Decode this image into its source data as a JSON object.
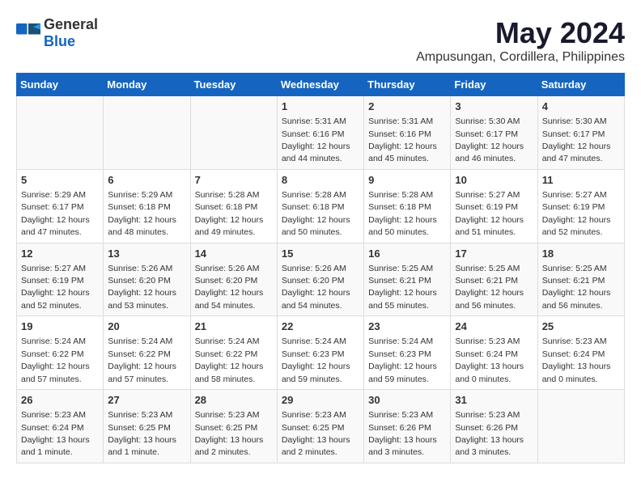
{
  "header": {
    "logo_general": "General",
    "logo_blue": "Blue",
    "month_title": "May 2024",
    "location": "Ampusungan, Cordillera, Philippines"
  },
  "days_of_week": [
    "Sunday",
    "Monday",
    "Tuesday",
    "Wednesday",
    "Thursday",
    "Friday",
    "Saturday"
  ],
  "weeks": [
    [
      {
        "day": "",
        "info": ""
      },
      {
        "day": "",
        "info": ""
      },
      {
        "day": "",
        "info": ""
      },
      {
        "day": "1",
        "info": "Sunrise: 5:31 AM\nSunset: 6:16 PM\nDaylight: 12 hours\nand 44 minutes."
      },
      {
        "day": "2",
        "info": "Sunrise: 5:31 AM\nSunset: 6:16 PM\nDaylight: 12 hours\nand 45 minutes."
      },
      {
        "day": "3",
        "info": "Sunrise: 5:30 AM\nSunset: 6:17 PM\nDaylight: 12 hours\nand 46 minutes."
      },
      {
        "day": "4",
        "info": "Sunrise: 5:30 AM\nSunset: 6:17 PM\nDaylight: 12 hours\nand 47 minutes."
      }
    ],
    [
      {
        "day": "5",
        "info": "Sunrise: 5:29 AM\nSunset: 6:17 PM\nDaylight: 12 hours\nand 47 minutes."
      },
      {
        "day": "6",
        "info": "Sunrise: 5:29 AM\nSunset: 6:18 PM\nDaylight: 12 hours\nand 48 minutes."
      },
      {
        "day": "7",
        "info": "Sunrise: 5:28 AM\nSunset: 6:18 PM\nDaylight: 12 hours\nand 49 minutes."
      },
      {
        "day": "8",
        "info": "Sunrise: 5:28 AM\nSunset: 6:18 PM\nDaylight: 12 hours\nand 50 minutes."
      },
      {
        "day": "9",
        "info": "Sunrise: 5:28 AM\nSunset: 6:18 PM\nDaylight: 12 hours\nand 50 minutes."
      },
      {
        "day": "10",
        "info": "Sunrise: 5:27 AM\nSunset: 6:19 PM\nDaylight: 12 hours\nand 51 minutes."
      },
      {
        "day": "11",
        "info": "Sunrise: 5:27 AM\nSunset: 6:19 PM\nDaylight: 12 hours\nand 52 minutes."
      }
    ],
    [
      {
        "day": "12",
        "info": "Sunrise: 5:27 AM\nSunset: 6:19 PM\nDaylight: 12 hours\nand 52 minutes."
      },
      {
        "day": "13",
        "info": "Sunrise: 5:26 AM\nSunset: 6:20 PM\nDaylight: 12 hours\nand 53 minutes."
      },
      {
        "day": "14",
        "info": "Sunrise: 5:26 AM\nSunset: 6:20 PM\nDaylight: 12 hours\nand 54 minutes."
      },
      {
        "day": "15",
        "info": "Sunrise: 5:26 AM\nSunset: 6:20 PM\nDaylight: 12 hours\nand 54 minutes."
      },
      {
        "day": "16",
        "info": "Sunrise: 5:25 AM\nSunset: 6:21 PM\nDaylight: 12 hours\nand 55 minutes."
      },
      {
        "day": "17",
        "info": "Sunrise: 5:25 AM\nSunset: 6:21 PM\nDaylight: 12 hours\nand 56 minutes."
      },
      {
        "day": "18",
        "info": "Sunrise: 5:25 AM\nSunset: 6:21 PM\nDaylight: 12 hours\nand 56 minutes."
      }
    ],
    [
      {
        "day": "19",
        "info": "Sunrise: 5:24 AM\nSunset: 6:22 PM\nDaylight: 12 hours\nand 57 minutes."
      },
      {
        "day": "20",
        "info": "Sunrise: 5:24 AM\nSunset: 6:22 PM\nDaylight: 12 hours\nand 57 minutes."
      },
      {
        "day": "21",
        "info": "Sunrise: 5:24 AM\nSunset: 6:22 PM\nDaylight: 12 hours\nand 58 minutes."
      },
      {
        "day": "22",
        "info": "Sunrise: 5:24 AM\nSunset: 6:23 PM\nDaylight: 12 hours\nand 59 minutes."
      },
      {
        "day": "23",
        "info": "Sunrise: 5:24 AM\nSunset: 6:23 PM\nDaylight: 12 hours\nand 59 minutes."
      },
      {
        "day": "24",
        "info": "Sunrise: 5:23 AM\nSunset: 6:24 PM\nDaylight: 13 hours\nand 0 minutes."
      },
      {
        "day": "25",
        "info": "Sunrise: 5:23 AM\nSunset: 6:24 PM\nDaylight: 13 hours\nand 0 minutes."
      }
    ],
    [
      {
        "day": "26",
        "info": "Sunrise: 5:23 AM\nSunset: 6:24 PM\nDaylight: 13 hours\nand 1 minute."
      },
      {
        "day": "27",
        "info": "Sunrise: 5:23 AM\nSunset: 6:25 PM\nDaylight: 13 hours\nand 1 minute."
      },
      {
        "day": "28",
        "info": "Sunrise: 5:23 AM\nSunset: 6:25 PM\nDaylight: 13 hours\nand 2 minutes."
      },
      {
        "day": "29",
        "info": "Sunrise: 5:23 AM\nSunset: 6:25 PM\nDaylight: 13 hours\nand 2 minutes."
      },
      {
        "day": "30",
        "info": "Sunrise: 5:23 AM\nSunset: 6:26 PM\nDaylight: 13 hours\nand 3 minutes."
      },
      {
        "day": "31",
        "info": "Sunrise: 5:23 AM\nSunset: 6:26 PM\nDaylight: 13 hours\nand 3 minutes."
      },
      {
        "day": "",
        "info": ""
      }
    ]
  ]
}
